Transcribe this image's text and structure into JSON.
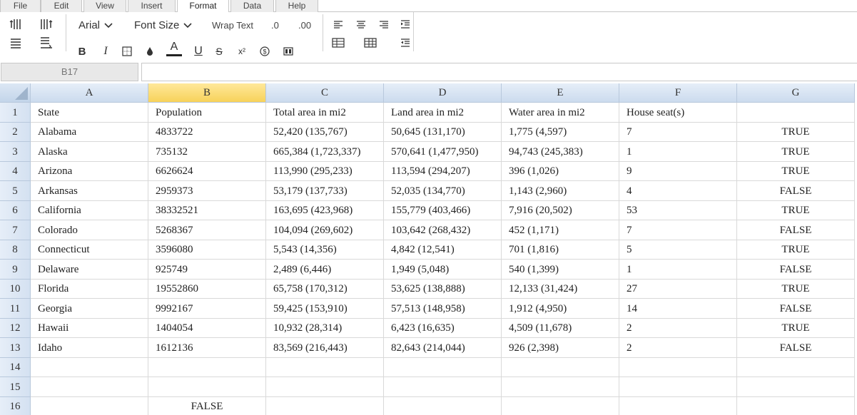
{
  "menu": {
    "tabs": [
      "File",
      "Edit",
      "View",
      "Insert",
      "Format",
      "Data",
      "Help"
    ],
    "active": "Format"
  },
  "toolbar": {
    "font_name": "Arial",
    "font_size_label": "Font Size",
    "wrap_text_label": "Wrap Text",
    "decrease_decimal_label": ".0",
    "increase_decimal_label": ".00",
    "bold_label": "B",
    "italic_label": "I",
    "font_color_label": "A",
    "underline_label": "U",
    "strike_label": "S",
    "superscript_label": "x²",
    "font_color_hex": "#222222"
  },
  "formula_bar": {
    "cell_ref": "B17",
    "value": ""
  },
  "sheet": {
    "columns": [
      "A",
      "B",
      "C",
      "D",
      "E",
      "F",
      "G"
    ],
    "selected_column": "B",
    "row_numbers": [
      "1",
      "2",
      "3",
      "4",
      "5",
      "6",
      "7",
      "8",
      "9",
      "10",
      "11",
      "12",
      "13",
      "14",
      "15",
      "16"
    ],
    "rows": [
      [
        "State",
        "Population",
        "Total area in mi2",
        "Land area in mi2",
        "Water area in mi2",
        "House seat(s)",
        ""
      ],
      [
        "Alabama",
        "4833722",
        "52,420 (135,767)",
        "50,645 (131,170)",
        "1,775 (4,597)",
        "7",
        "TRUE"
      ],
      [
        "Alaska",
        "735132",
        "665,384 (1,723,337)",
        "570,641 (1,477,950)",
        "94,743 (245,383)",
        "1",
        "TRUE"
      ],
      [
        "Arizona",
        "6626624",
        "113,990 (295,233)",
        "113,594 (294,207)",
        "396 (1,026)",
        "9",
        "TRUE"
      ],
      [
        "Arkansas",
        "2959373",
        "53,179 (137,733)",
        "52,035 (134,770)",
        "1,143 (2,960)",
        "4",
        "FALSE"
      ],
      [
        "California",
        "38332521",
        "163,695 (423,968)",
        "155,779 (403,466)",
        "7,916 (20,502)",
        "53",
        "TRUE"
      ],
      [
        "Colorado",
        "5268367",
        "104,094 (269,602)",
        "103,642 (268,432)",
        "452 (1,171)",
        "7",
        "FALSE"
      ],
      [
        "Connecticut",
        "3596080",
        "5,543 (14,356)",
        "4,842 (12,541)",
        "701 (1,816)",
        "5",
        "TRUE"
      ],
      [
        "Delaware",
        "925749",
        "2,489 (6,446)",
        "1,949 (5,048)",
        "540 (1,399)",
        "1",
        "FALSE"
      ],
      [
        "Florida",
        "19552860",
        "65,758 (170,312)",
        "53,625 (138,888)",
        "12,133 (31,424)",
        "27",
        "TRUE"
      ],
      [
        "Georgia",
        "9992167",
        "59,425 (153,910)",
        "57,513 (148,958)",
        "1,912 (4,950)",
        "14",
        "FALSE"
      ],
      [
        "Hawaii",
        "1404054",
        "10,932 (28,314)",
        "6,423 (16,635)",
        "4,509 (11,678)",
        "2",
        "TRUE"
      ],
      [
        "Idaho",
        "1612136",
        "83,569 (216,443)",
        "82,643 (214,044)",
        "926 (2,398)",
        "2",
        "FALSE"
      ],
      [
        "",
        "",
        "",
        "",
        "",
        "",
        ""
      ],
      [
        "",
        "",
        "",
        "",
        "",
        "",
        ""
      ],
      [
        "",
        "FALSE",
        "",
        "",
        "",
        "",
        ""
      ]
    ]
  },
  "colors": {
    "selected_header": "#f7d25a",
    "header_bg": "#ccdbee",
    "grid_line": "#d9d9d9"
  }
}
